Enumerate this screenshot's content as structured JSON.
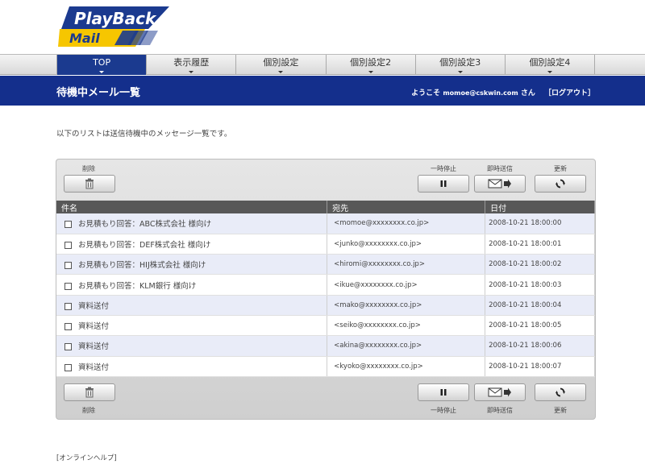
{
  "logo": {
    "line1": "PlayBack",
    "line2": "Mail"
  },
  "nav": {
    "items": [
      {
        "label": "TOP",
        "active": true
      },
      {
        "label": "表示履歴",
        "active": false
      },
      {
        "label": "個別設定",
        "active": false
      },
      {
        "label": "個別設定2",
        "active": false
      },
      {
        "label": "個別設定3",
        "active": false
      },
      {
        "label": "個別設定4",
        "active": false
      }
    ]
  },
  "header": {
    "title": "待機中メール一覧",
    "welcome_prefix": "ようこそ",
    "user": "momoe@cskwin.com",
    "welcome_suffix": "さん",
    "logout": "［ログアウト］"
  },
  "intro": "以下のリストは送信待機中のメッセージ一覧です。",
  "toolbar": {
    "delete_label": "削除",
    "pause_label": "一時停止",
    "send_now_label": "即時送信",
    "refresh_label": "更新"
  },
  "table": {
    "headers": {
      "subject": "件名",
      "to": "宛先",
      "date": "日付"
    },
    "rows": [
      {
        "subject": "お見積もり回答：ABC株式会社 様向け",
        "to": "<momoe@xxxxxxxx.co.jp>",
        "date": "2008-10-21 18:00:00"
      },
      {
        "subject": "お見積もり回答：DEF株式会社 様向け",
        "to": "<junko@xxxxxxxx.co.jp>",
        "date": "2008-10-21 18:00:01"
      },
      {
        "subject": "お見積もり回答：HIJ株式会社 様向け",
        "to": "<hiromi@xxxxxxxx.co.jp>",
        "date": "2008-10-21 18:00:02"
      },
      {
        "subject": "お見積もり回答：KLM銀行 様向け",
        "to": "<ikue@xxxxxxxx.co.jp>",
        "date": "2008-10-21 18:00:03"
      },
      {
        "subject": "資料送付",
        "to": "<mako@xxxxxxxx.co.jp>",
        "date": "2008-10-21 18:00:04"
      },
      {
        "subject": "資料送付",
        "to": "<seiko@xxxxxxxx.co.jp>",
        "date": "2008-10-21 18:00:05"
      },
      {
        "subject": "資料送付",
        "to": "<akina@xxxxxxxx.co.jp>",
        "date": "2008-10-21 18:00:06"
      },
      {
        "subject": "資料送付",
        "to": "<kyoko@xxxxxxxx.co.jp>",
        "date": "2008-10-21 18:00:07"
      }
    ]
  },
  "footer": {
    "help": "[オンラインヘルプ]"
  },
  "colors": {
    "brand_blue": "#142f8c",
    "logo_yellow": "#f6c600",
    "row_tint": "#e9ecf8"
  },
  "icons": {
    "delete": "trash-icon",
    "pause": "pause-icon",
    "send": "envelope-arrow-icon",
    "refresh": "refresh-icon"
  }
}
